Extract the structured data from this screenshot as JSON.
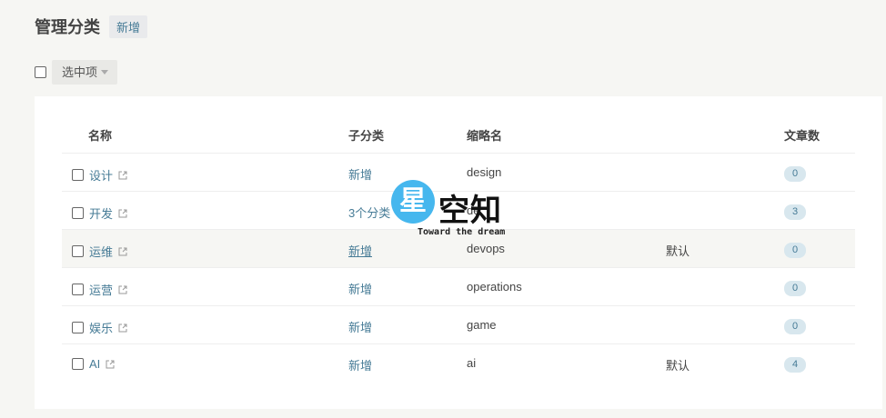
{
  "header": {
    "title": "管理分类",
    "new_label": "新增"
  },
  "toolbar": {
    "select_label": "选中项"
  },
  "table": {
    "columns": {
      "name": "名称",
      "sub": "子分类",
      "slug": "缩略名",
      "count": "文章数"
    },
    "rows": [
      {
        "name": "设计",
        "sub": "新增",
        "slug": "design",
        "default": "",
        "count": "0"
      },
      {
        "name": "开发",
        "sub": "3个分类",
        "slug": "de",
        "default": "",
        "count": "3"
      },
      {
        "name": "运维",
        "sub": "新增",
        "slug": "devops",
        "default": "默认",
        "count": "0"
      },
      {
        "name": "运营",
        "sub": "新增",
        "slug": "operations",
        "default": "",
        "count": "0"
      },
      {
        "name": "娱乐",
        "sub": "新增",
        "slug": "game",
        "default": "",
        "count": "0"
      },
      {
        "name": "AI",
        "sub": "新增",
        "slug": "ai",
        "default": "默认",
        "count": "4"
      }
    ]
  },
  "watermark": {
    "badge_char": "星",
    "text": "空知",
    "sub": "Toward the dream"
  },
  "colors": {
    "link": "#467b96",
    "badge_bg": "#d8e7ee",
    "page_bg": "#f6f6f3"
  }
}
